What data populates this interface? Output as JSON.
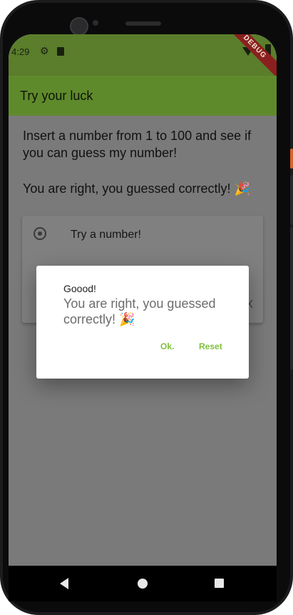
{
  "status_bar": {
    "time": "4:29",
    "debug_label": "DEBUG",
    "background_color": "#5a7e2b"
  },
  "app_bar": {
    "title": "Try your luck",
    "color": "#5f8a2c"
  },
  "main": {
    "instructions": "Insert a number from 1 to 100 and see if you can guess my number!",
    "result": "You are right, you guessed correctly! 🎉"
  },
  "card": {
    "radio_label": "Try a number!",
    "close_glyph": "X"
  },
  "dialog": {
    "title": "Goood!",
    "content": "You are right, you guessed correctly! 🎉",
    "ok_label": "Ok.",
    "reset_label": "Reset",
    "accent_color": "#7fbf3e"
  },
  "icons": {
    "status": [
      "gear-icon",
      "sim-card-icon",
      "wifi-icon",
      "battery-icon"
    ],
    "navigation": [
      "back-icon",
      "home-icon",
      "recents-icon"
    ],
    "card": [
      "radio-button-icon",
      "close-icon"
    ]
  }
}
